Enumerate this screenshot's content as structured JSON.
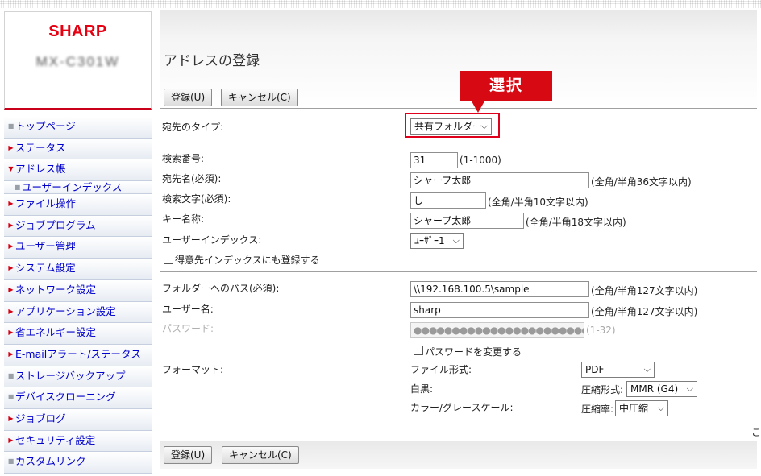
{
  "brand": "SHARP",
  "model": "MX-C301W",
  "nav": [
    {
      "label": "トップページ",
      "marker": "square"
    },
    {
      "label": "ステータス",
      "marker": "arrow"
    },
    {
      "label": "アドレス帳",
      "marker": "down"
    },
    {
      "label": "ユーザーインデックス",
      "marker": "square",
      "sub": true
    },
    {
      "label": "ファイル操作",
      "marker": "arrow"
    },
    {
      "label": "ジョブプログラム",
      "marker": "arrow"
    },
    {
      "label": "ユーザー管理",
      "marker": "arrow"
    },
    {
      "label": "システム設定",
      "marker": "arrow"
    },
    {
      "label": "ネットワーク設定",
      "marker": "arrow"
    },
    {
      "label": "アプリケーション設定",
      "marker": "arrow"
    },
    {
      "label": "省エネルギー設定",
      "marker": "arrow"
    },
    {
      "label": "E-mailアラート/ステータス",
      "marker": "arrow"
    },
    {
      "label": "ストレージバックアップ",
      "marker": "square"
    },
    {
      "label": "デバイスクローニング",
      "marker": "square"
    },
    {
      "label": "ジョブログ",
      "marker": "arrow"
    },
    {
      "label": "セキュリティ設定",
      "marker": "arrow"
    },
    {
      "label": "カスタムリンク",
      "marker": "square"
    }
  ],
  "page_title": "アドレスの登録",
  "buttons": {
    "register": "登録(U)",
    "cancel": "キャンセル(C)"
  },
  "callout": "選択",
  "form": {
    "dest_type": {
      "label": "宛先のタイプ:",
      "value": "共有フォルダー"
    },
    "search_no": {
      "label": "検索番号:",
      "value": "31",
      "hint": "(1-1000)"
    },
    "dest_name": {
      "label": "宛先名(必須):",
      "value": "シャープ太郎",
      "hint": "(全角/半角36文字以内)"
    },
    "search_char": {
      "label": "検索文字(必須):",
      "value": "し",
      "hint": "(全角/半角10文字以内)"
    },
    "key_name": {
      "label": "キー名称:",
      "value": "シャープ太郎",
      "hint": "(全角/半角18文字以内)"
    },
    "user_index": {
      "label": "ユーザーインデックス:",
      "value": "ﾕｰｻﾞｰ1"
    },
    "favorite_cb": {
      "label": "得意先インデックスにも登録する"
    },
    "folder_path": {
      "label": "フォルダーへのパス(必須):",
      "value": "\\\\192.168.100.5\\sample",
      "hint": "(全角/半角127文字以内)"
    },
    "user_name": {
      "label": "ユーザー名:",
      "value": "sharp",
      "hint": "(全角/半角127文字以内)"
    },
    "password": {
      "label": "パスワード:",
      "value": "●●●●●●●●●●●●●●●●●●●●●●●●●●●●●",
      "hint": "(1-32)"
    },
    "change_pw_cb": {
      "label": "パスワードを変更する"
    },
    "format": {
      "label": "フォーマット:",
      "file_format_label": "ファイル形式:",
      "file_format_value": "PDF",
      "bw_label": "白黒:",
      "compression_label": "圧縮形式:",
      "compression_value": "MMR (G4)",
      "color_label": "カラー/グレースケール:",
      "ratio_label": "圧縮率:",
      "ratio_value": "中圧縮"
    }
  },
  "edge_char": "こ"
}
